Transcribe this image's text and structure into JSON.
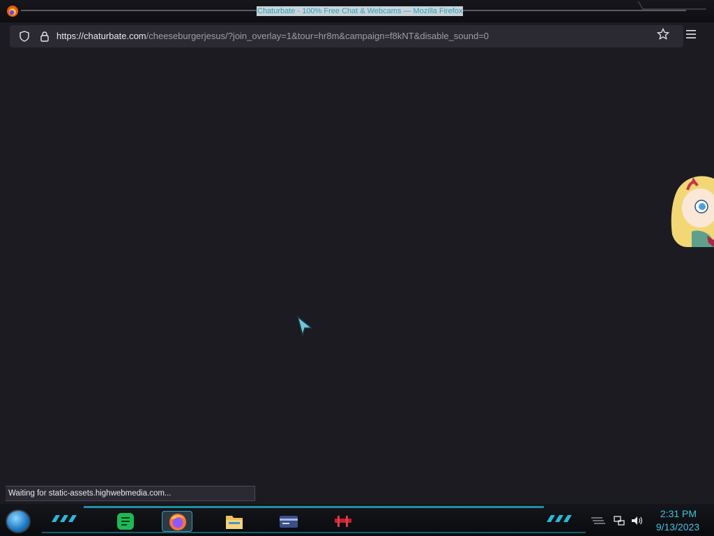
{
  "window": {
    "title": "Chaturbate - 100% Free Chat & Webcams — Mozilla Firefox"
  },
  "addressbar": {
    "url_host": "https://chaturbate.com",
    "url_path": "/cheeseburgerjesus/?join_overlay=1&tour=hr8m&campaign=f8kNT&disable_sound=0"
  },
  "status": {
    "text": "Waiting for static-assets.highwebmedia.com..."
  },
  "taskbar": {
    "time": "2:31 PM",
    "date": "9/13/2023",
    "apps": [
      "start-orb-icon",
      "notes-app-icon",
      "firefox-icon",
      "file-explorer-icon",
      "card-app-icon",
      "red-app-icon"
    ]
  },
  "colors": {
    "page_background": "#1c1b22",
    "urlbar": "#2b2a33",
    "accent": "#3ec3e0"
  }
}
